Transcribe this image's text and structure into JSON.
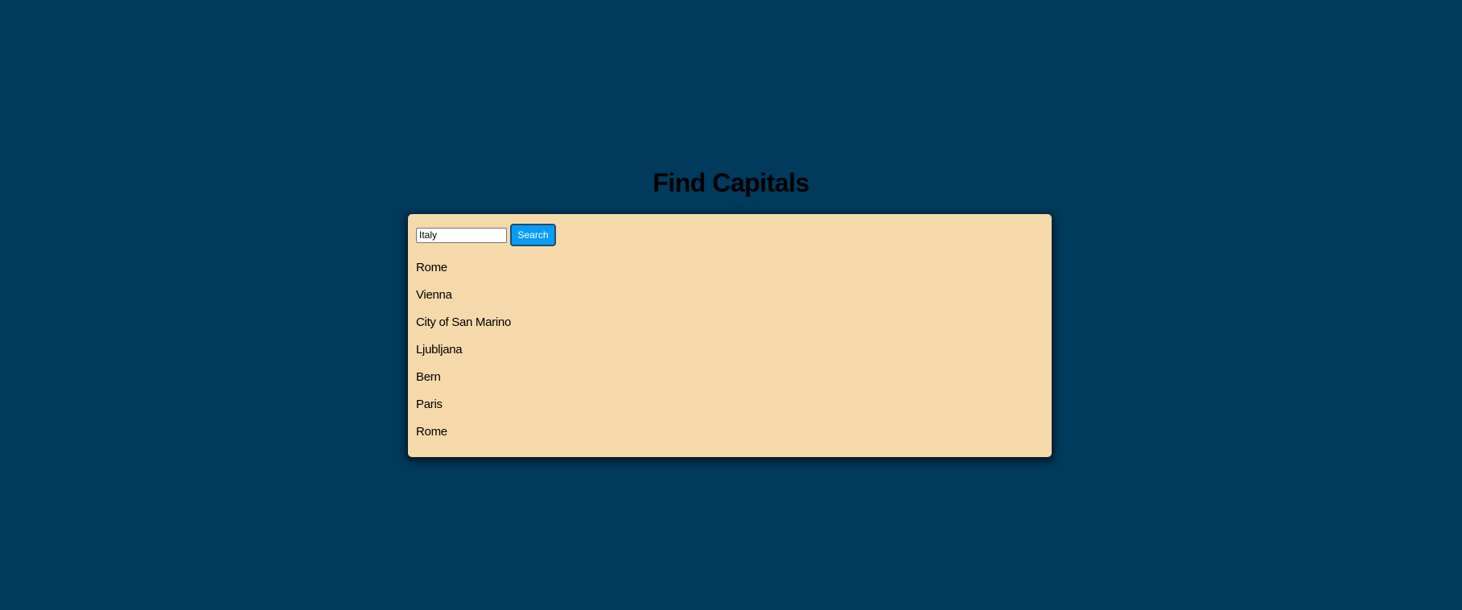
{
  "header": {
    "title": "Find Capitals"
  },
  "search": {
    "value": "Italy",
    "button_label": "Search"
  },
  "results": [
    "Rome",
    "Vienna",
    "City of San Marino",
    "Ljubljana",
    "Bern",
    "Paris",
    "Rome"
  ],
  "colors": {
    "background": "#003a5c",
    "card": "#f5d9aa",
    "button": "#0a9cf2",
    "button_text": "#ffffff"
  }
}
